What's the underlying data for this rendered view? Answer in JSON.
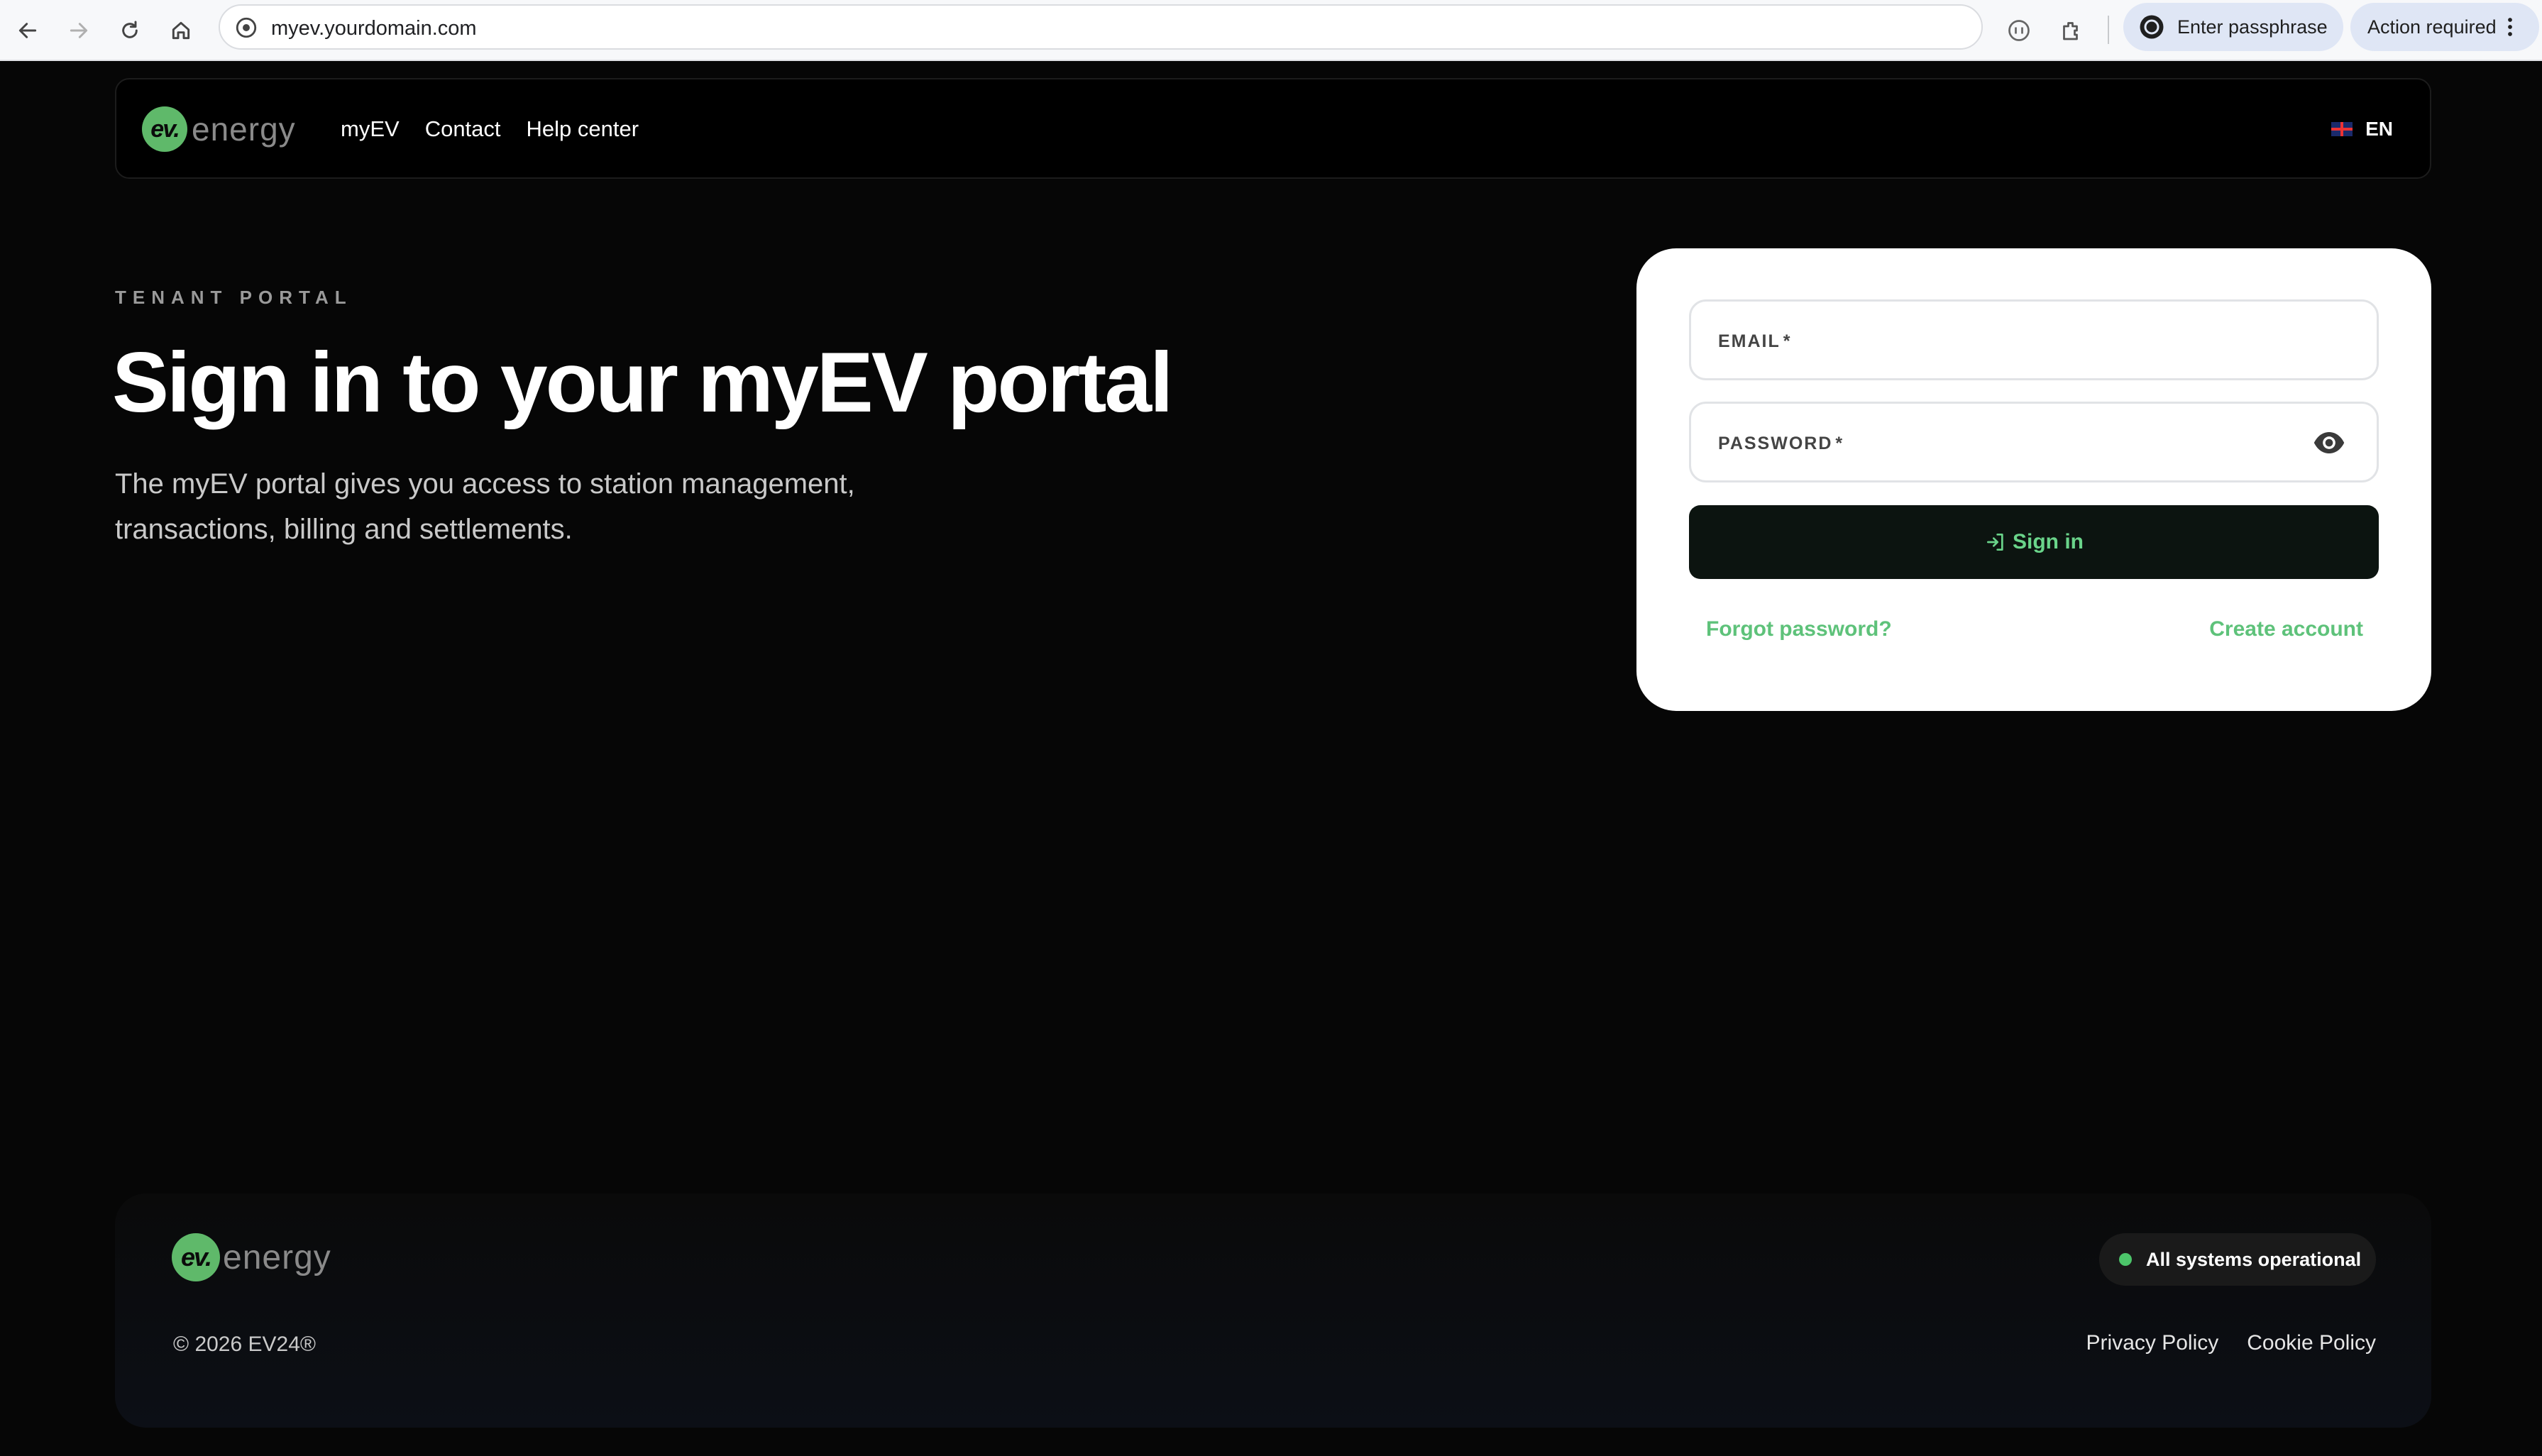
{
  "browser": {
    "url": "myev.yourdomain.com",
    "passphrase_label": "Enter passphrase",
    "action_label": "Action required",
    "icons": [
      "back-arrow-icon",
      "forward-arrow-icon",
      "reload-icon",
      "home-icon",
      "site-info-icon",
      "reader-icon",
      "extensions-icon",
      "profile-icon",
      "kebab-menu-icon"
    ]
  },
  "header": {
    "logo_badge": "ev.",
    "logo_word": "energy",
    "nav": [
      {
        "label": "myEV"
      },
      {
        "label": "Contact"
      },
      {
        "label": "Help center"
      }
    ],
    "language": "EN"
  },
  "hero": {
    "eyebrow": "TENANT PORTAL",
    "title": "Sign in to your myEV portal",
    "subtitle": "The myEV portal gives you access to station management, transactions, billing and settlements."
  },
  "login": {
    "email_label": "EMAIL",
    "password_label": "PASSWORD",
    "required_mark": "*",
    "sign_in_label": "Sign in",
    "forgot_label": "Forgot password?",
    "create_label": "Create account"
  },
  "footer": {
    "logo_badge": "ev.",
    "logo_word": "energy",
    "status": "All systems operational",
    "copyright": "© 2026 EV24®",
    "links": [
      {
        "label": "Privacy Policy"
      },
      {
        "label": "Cookie Policy"
      }
    ]
  },
  "colors": {
    "accent_green": "#5ec27a",
    "logo_green": "#5fb96a",
    "page_bg": "#060606",
    "card_bg": "#ffffff",
    "button_bg": "#0c1410"
  }
}
